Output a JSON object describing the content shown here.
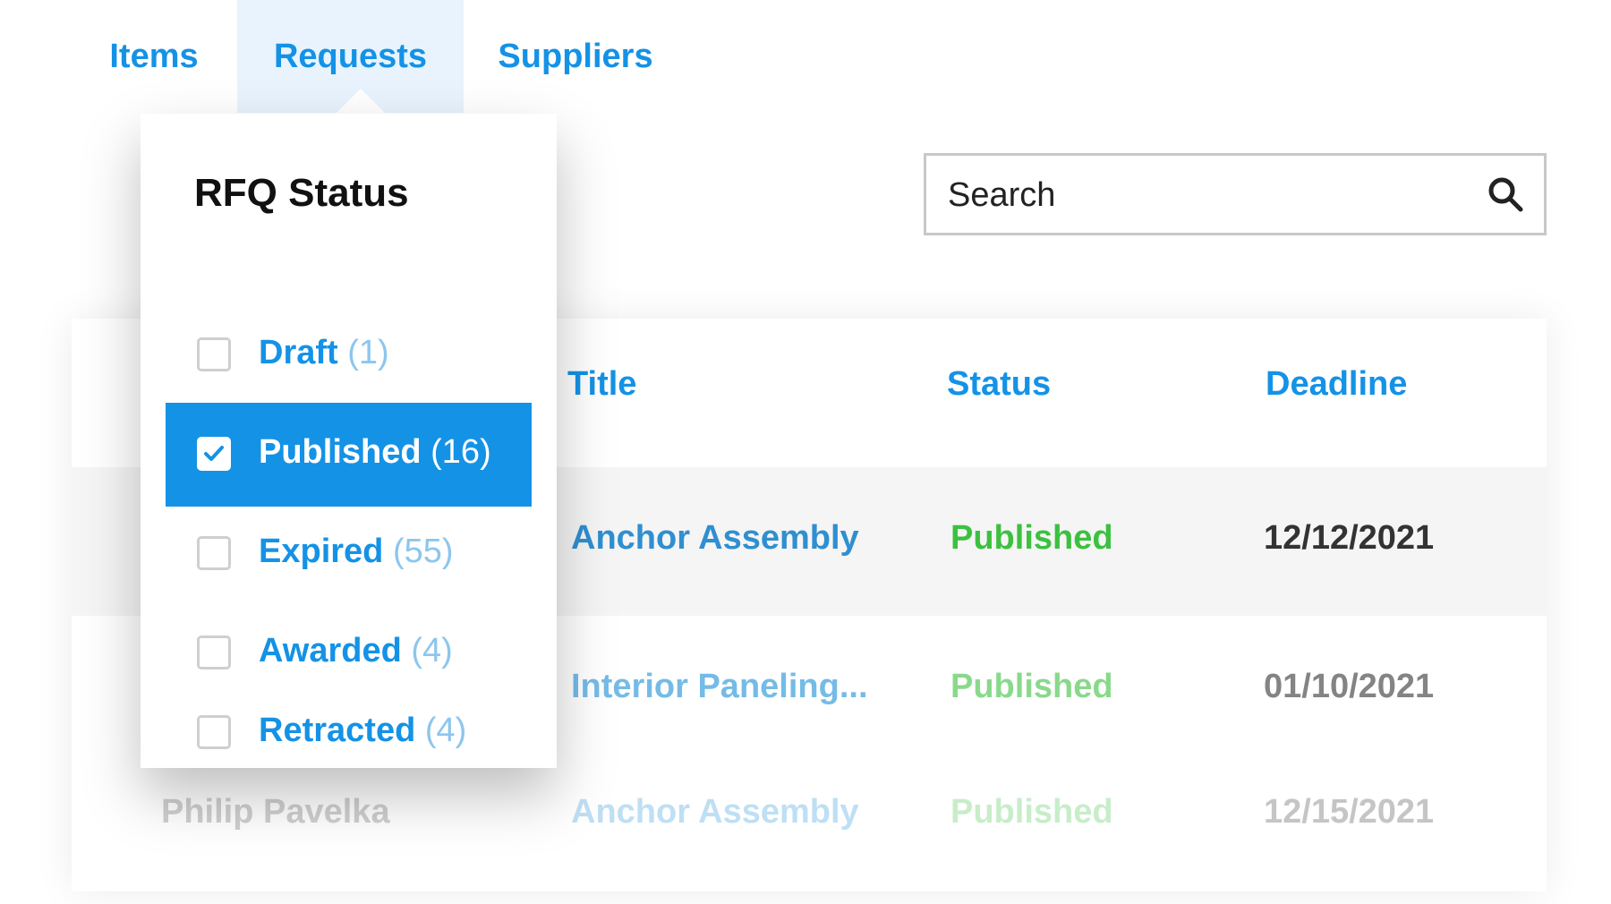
{
  "tabs": [
    {
      "label": "Items"
    },
    {
      "label": "Requests",
      "active": true
    },
    {
      "label": "Suppliers"
    }
  ],
  "search": {
    "placeholder": "Search",
    "icon": "search-icon"
  },
  "filter": {
    "title": "RFQ Status",
    "options": [
      {
        "label": "Draft",
        "count": "(1)",
        "checked": false
      },
      {
        "label": "Published",
        "count": "(16)",
        "checked": true
      },
      {
        "label": "Expired",
        "count": "(55)",
        "checked": false
      },
      {
        "label": "Awarded",
        "count": "(4)",
        "checked": false
      },
      {
        "label": "Retracted",
        "count": "(4)",
        "checked": false
      }
    ]
  },
  "table": {
    "columns": [
      "Title",
      "Status",
      "Deadline"
    ],
    "rows": [
      {
        "name": "",
        "title": "Anchor Assembly",
        "status": "Published",
        "deadline": "12/12/2021"
      },
      {
        "name": "",
        "title": "Interior Paneling...",
        "status": "Published",
        "deadline": "01/10/2021"
      },
      {
        "name": "Philip Pavelka",
        "title": "Anchor Assembly",
        "status": "Published",
        "deadline": "12/15/2021"
      }
    ]
  },
  "colors": {
    "accent": "#1492e6",
    "status_published": "#3bc13f",
    "tab_active_bg": "#e8f3fd"
  }
}
